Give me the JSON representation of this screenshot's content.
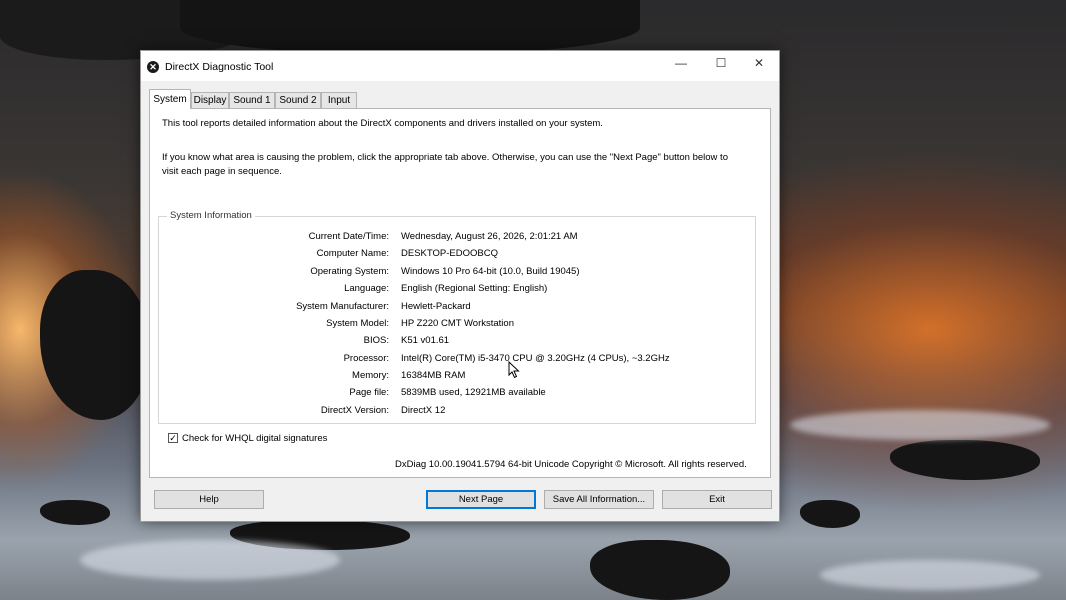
{
  "window": {
    "title": "DirectX Diagnostic Tool",
    "minimize_glyph": "—",
    "maximize_glyph": "☐",
    "close_glyph": "✕"
  },
  "tabs": [
    {
      "label": "System",
      "active": true
    },
    {
      "label": "Display",
      "active": false
    },
    {
      "label": "Sound 1",
      "active": false
    },
    {
      "label": "Sound 2",
      "active": false
    },
    {
      "label": "Input",
      "active": false
    }
  ],
  "intro": {
    "line1": "This tool reports detailed information about the DirectX components and drivers installed on your system.",
    "line2": "If you know what area is causing the problem, click the appropriate tab above.  Otherwise, you can use the \"Next Page\" button below to",
    "line3": "visit each page in sequence."
  },
  "system_info": {
    "legend": "System Information",
    "rows": [
      {
        "label": "Current Date/Time:",
        "value": "Wednesday, August 26, 2026, 2:01:21 AM"
      },
      {
        "label": "Computer Name:",
        "value": "DESKTOP-EDOOBCQ"
      },
      {
        "label": "Operating System:",
        "value": "Windows 10 Pro 64-bit (10.0, Build 19045)"
      },
      {
        "label": "Language:",
        "value": "English (Regional Setting: English)"
      },
      {
        "label": "System Manufacturer:",
        "value": "Hewlett-Packard"
      },
      {
        "label": "System Model:",
        "value": "HP Z220 CMT Workstation"
      },
      {
        "label": "BIOS:",
        "value": "K51 v01.61"
      },
      {
        "label": "Processor:",
        "value": "Intel(R) Core(TM) i5-3470 CPU @ 3.20GHz (4 CPUs), ~3.2GHz"
      },
      {
        "label": "Memory:",
        "value": "16384MB RAM"
      },
      {
        "label": "Page file:",
        "value": "5839MB used, 12921MB available"
      },
      {
        "label": "DirectX Version:",
        "value": "DirectX 12"
      }
    ]
  },
  "whql": {
    "label": "Check for WHQL digital signatures",
    "checked": true
  },
  "copyright": "DxDiag 10.00.19041.5794 64-bit Unicode  Copyright © Microsoft. All rights reserved.",
  "buttons": {
    "help": "Help",
    "next_page": "Next Page",
    "save_all": "Save All Information...",
    "exit": "Exit"
  },
  "colors": {
    "accent": "#0078d7",
    "window_bg": "#f0f0f0",
    "panel_bg": "#ffffff"
  }
}
